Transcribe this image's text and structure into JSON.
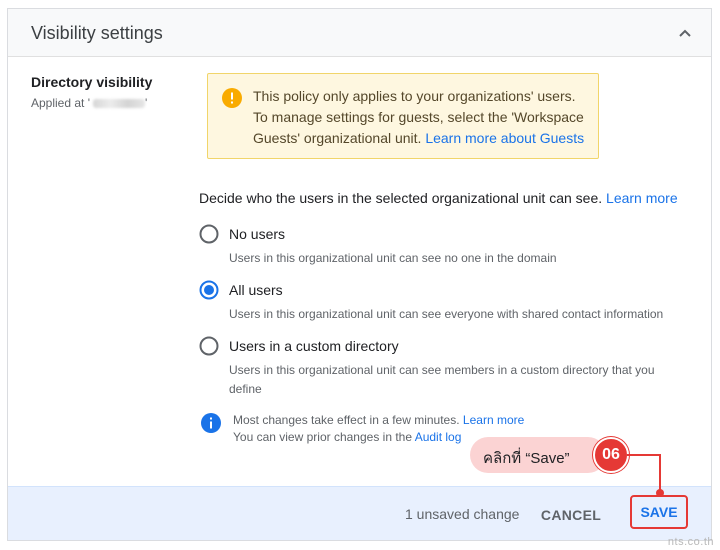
{
  "header": {
    "title": "Visibility settings"
  },
  "section": {
    "title": "Directory visibility",
    "applied_prefix": "Applied at '",
    "applied_suffix": "'"
  },
  "warning": {
    "text": "This policy only applies to your organizations' users. To manage settings for guests, select the 'Workspace Guests' organizational unit.",
    "link": "Learn more about Guests"
  },
  "decide": {
    "text": "Decide who the users in the selected organizational unit can see.",
    "link": "Learn more"
  },
  "options": [
    {
      "label": "No users",
      "description": "Users in this organizational unit can see no one in the domain",
      "selected": false
    },
    {
      "label": "All users",
      "description": "Users in this organizational unit can see everyone with shared contact information",
      "selected": true
    },
    {
      "label": "Users in a custom directory",
      "description": "Users in this organizational unit can see members in a custom directory that you define",
      "selected": false
    }
  ],
  "info": {
    "line1": "Most changes take effect in a few minutes.",
    "line1_link": "Learn more",
    "line2": "You can view prior changes in the",
    "line2_link": "Audit log"
  },
  "footer": {
    "unsaved": "1 unsaved change",
    "cancel": "CANCEL",
    "save": "SAVE"
  },
  "callout": {
    "text": "คลิกที่ “Save”",
    "step": "06"
  },
  "watermark": "nts.co.th",
  "colors": {
    "accent": "#1a73e8",
    "warning_bg": "#fef7e0",
    "warning_icon": "#f9ab00",
    "callout": "#e53935",
    "footer_bg": "#e8f0fe"
  },
  "icons": {
    "collapse": "chevron-up-icon",
    "warning": "warning-icon",
    "info": "info-icon"
  }
}
